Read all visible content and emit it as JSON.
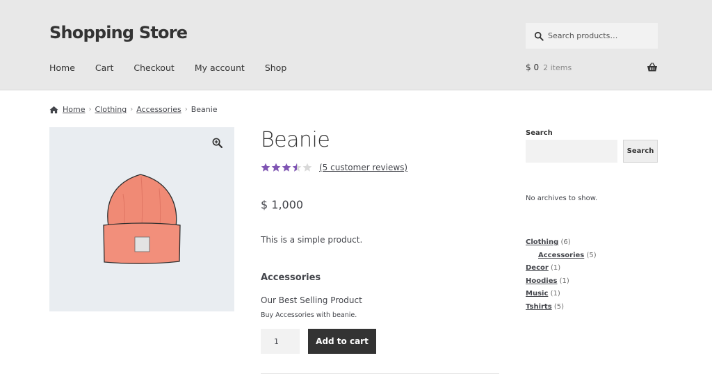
{
  "header": {
    "site_title": "Shopping Store",
    "search_placeholder": "Search products…",
    "nav": [
      "Home",
      "Cart",
      "Checkout",
      "My account",
      "Shop"
    ],
    "cart_amount": "$ 0",
    "cart_count": "2 items",
    "bg_color": "#e8e8e8"
  },
  "breadcrumb": {
    "items": [
      "Home",
      "Clothing",
      "Accessories"
    ],
    "current": "Beanie",
    "separator": "›"
  },
  "product": {
    "title": "Beanie",
    "rating": 3.5,
    "rating_max": 5,
    "star_color": "#7f54b3",
    "reviews_link": "(5 customer reviews)",
    "price": "$ 1,000",
    "short_description": "This is a simple product.",
    "section_heading": "Accessories",
    "bundle_title": "Our Best Selling Product",
    "bundle_desc": "Buy Accessories with beanie.",
    "quantity": "1",
    "add_to_cart_label": "Add to cart"
  },
  "sidebar": {
    "search_widget_title": "Search",
    "search_button": "Search",
    "no_archives": "No archives to show.",
    "categories": [
      {
        "name": "Clothing",
        "count": "(6)",
        "sub": false
      },
      {
        "name": "Accessories",
        "count": "(5)",
        "sub": true
      },
      {
        "name": "Decor",
        "count": "(1)",
        "sub": false
      },
      {
        "name": "Hoodies",
        "count": "(1)",
        "sub": false
      },
      {
        "name": "Music",
        "count": "(1)",
        "sub": false
      },
      {
        "name": "Tshirts",
        "count": "(5)",
        "sub": false
      }
    ]
  }
}
